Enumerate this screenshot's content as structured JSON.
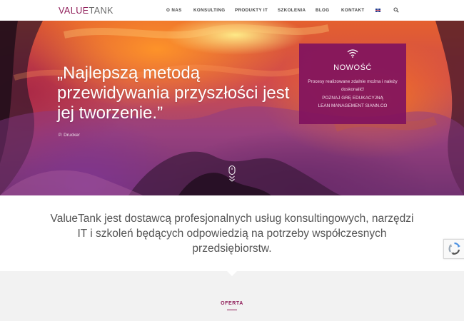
{
  "logo": {
    "part1": "VALUE",
    "part2": "TANK"
  },
  "nav": {
    "items": [
      {
        "label": "O NAS"
      },
      {
        "label": "KONSULTING"
      },
      {
        "label": "PRODUKTY IT"
      },
      {
        "label": "SZKOLENIA"
      },
      {
        "label": "BLOG"
      },
      {
        "label": "KONTAKT"
      }
    ]
  },
  "hero": {
    "quote": "„Najlepszą metodą przewidywania przyszłości jest jej tworzenie.”",
    "author": "P. Drucker"
  },
  "news": {
    "title": "NOWOŚĆ",
    "line1": "Procesy realizowane zdalnie można i należy",
    "line2": "doskonalić!",
    "line3": "POZNAJ GRĘ EDUKACYJNĄ",
    "line4": "LEAN MANAGEMENT SIANN.CO"
  },
  "intro": {
    "text": "ValueTank jest dostawcą profesjonalnych usług konsultingowych, narzędzi IT i szkoleń będących odpowiedzią na potrzeby współczesnych przedsiębiorstw."
  },
  "offer": {
    "title": "OFERTA"
  },
  "colors": {
    "brand": "#8e1a57",
    "news_box": "#80125e",
    "text_gray": "#555555"
  },
  "icons": {
    "language": "uk-flag-icon",
    "search": "search-icon",
    "news": "wifi-icon",
    "scroll": "mouse-scroll-icon",
    "captcha": "recaptcha-icon"
  }
}
